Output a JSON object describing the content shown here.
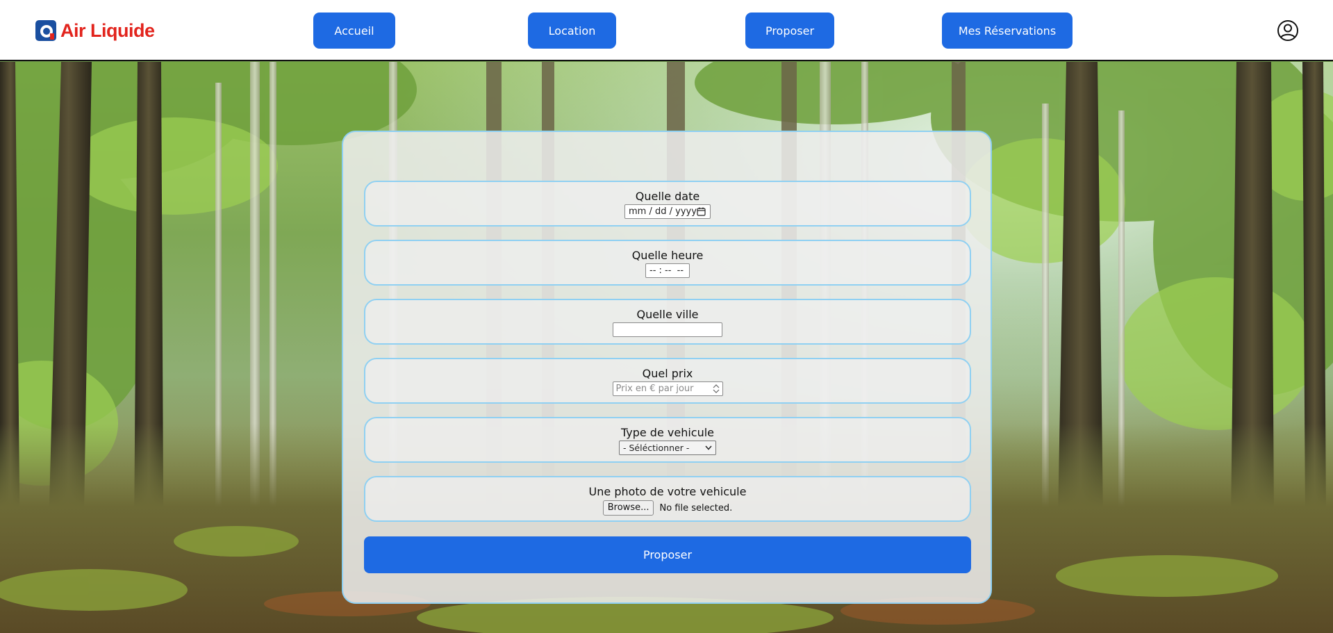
{
  "brand": {
    "name": "Air Liquide",
    "logo_icon": "air-liquide-logo-icon",
    "color": "#e2241d",
    "logo_blue": "#1a4fa0"
  },
  "nav": {
    "accent": "#1e6ae3",
    "items": [
      {
        "label": "Accueil"
      },
      {
        "label": "Location"
      },
      {
        "label": "Proposer"
      },
      {
        "label": "Mes Réservations"
      }
    ],
    "profile_icon": "user-circle-icon"
  },
  "form": {
    "border_color": "#8fd0f2",
    "date": {
      "label": "Quelle date",
      "value": "mm / dd / yyyy",
      "icon": "calendar-icon"
    },
    "time": {
      "label": "Quelle heure",
      "value": "-- : --  --"
    },
    "city": {
      "label": "Quelle ville",
      "value": ""
    },
    "price": {
      "label": "Quel prix",
      "placeholder": "Prix en € par jour",
      "icon": "spinner-arrows-icon"
    },
    "vehicle_type": {
      "label": "Type de vehicule",
      "selected": "- Séléctionner -",
      "icon": "chevron-down-icon"
    },
    "photo": {
      "label": "Une photo de votre vehicule",
      "button": "Browse...",
      "status": "No file selected."
    },
    "submit": "Proposer"
  }
}
